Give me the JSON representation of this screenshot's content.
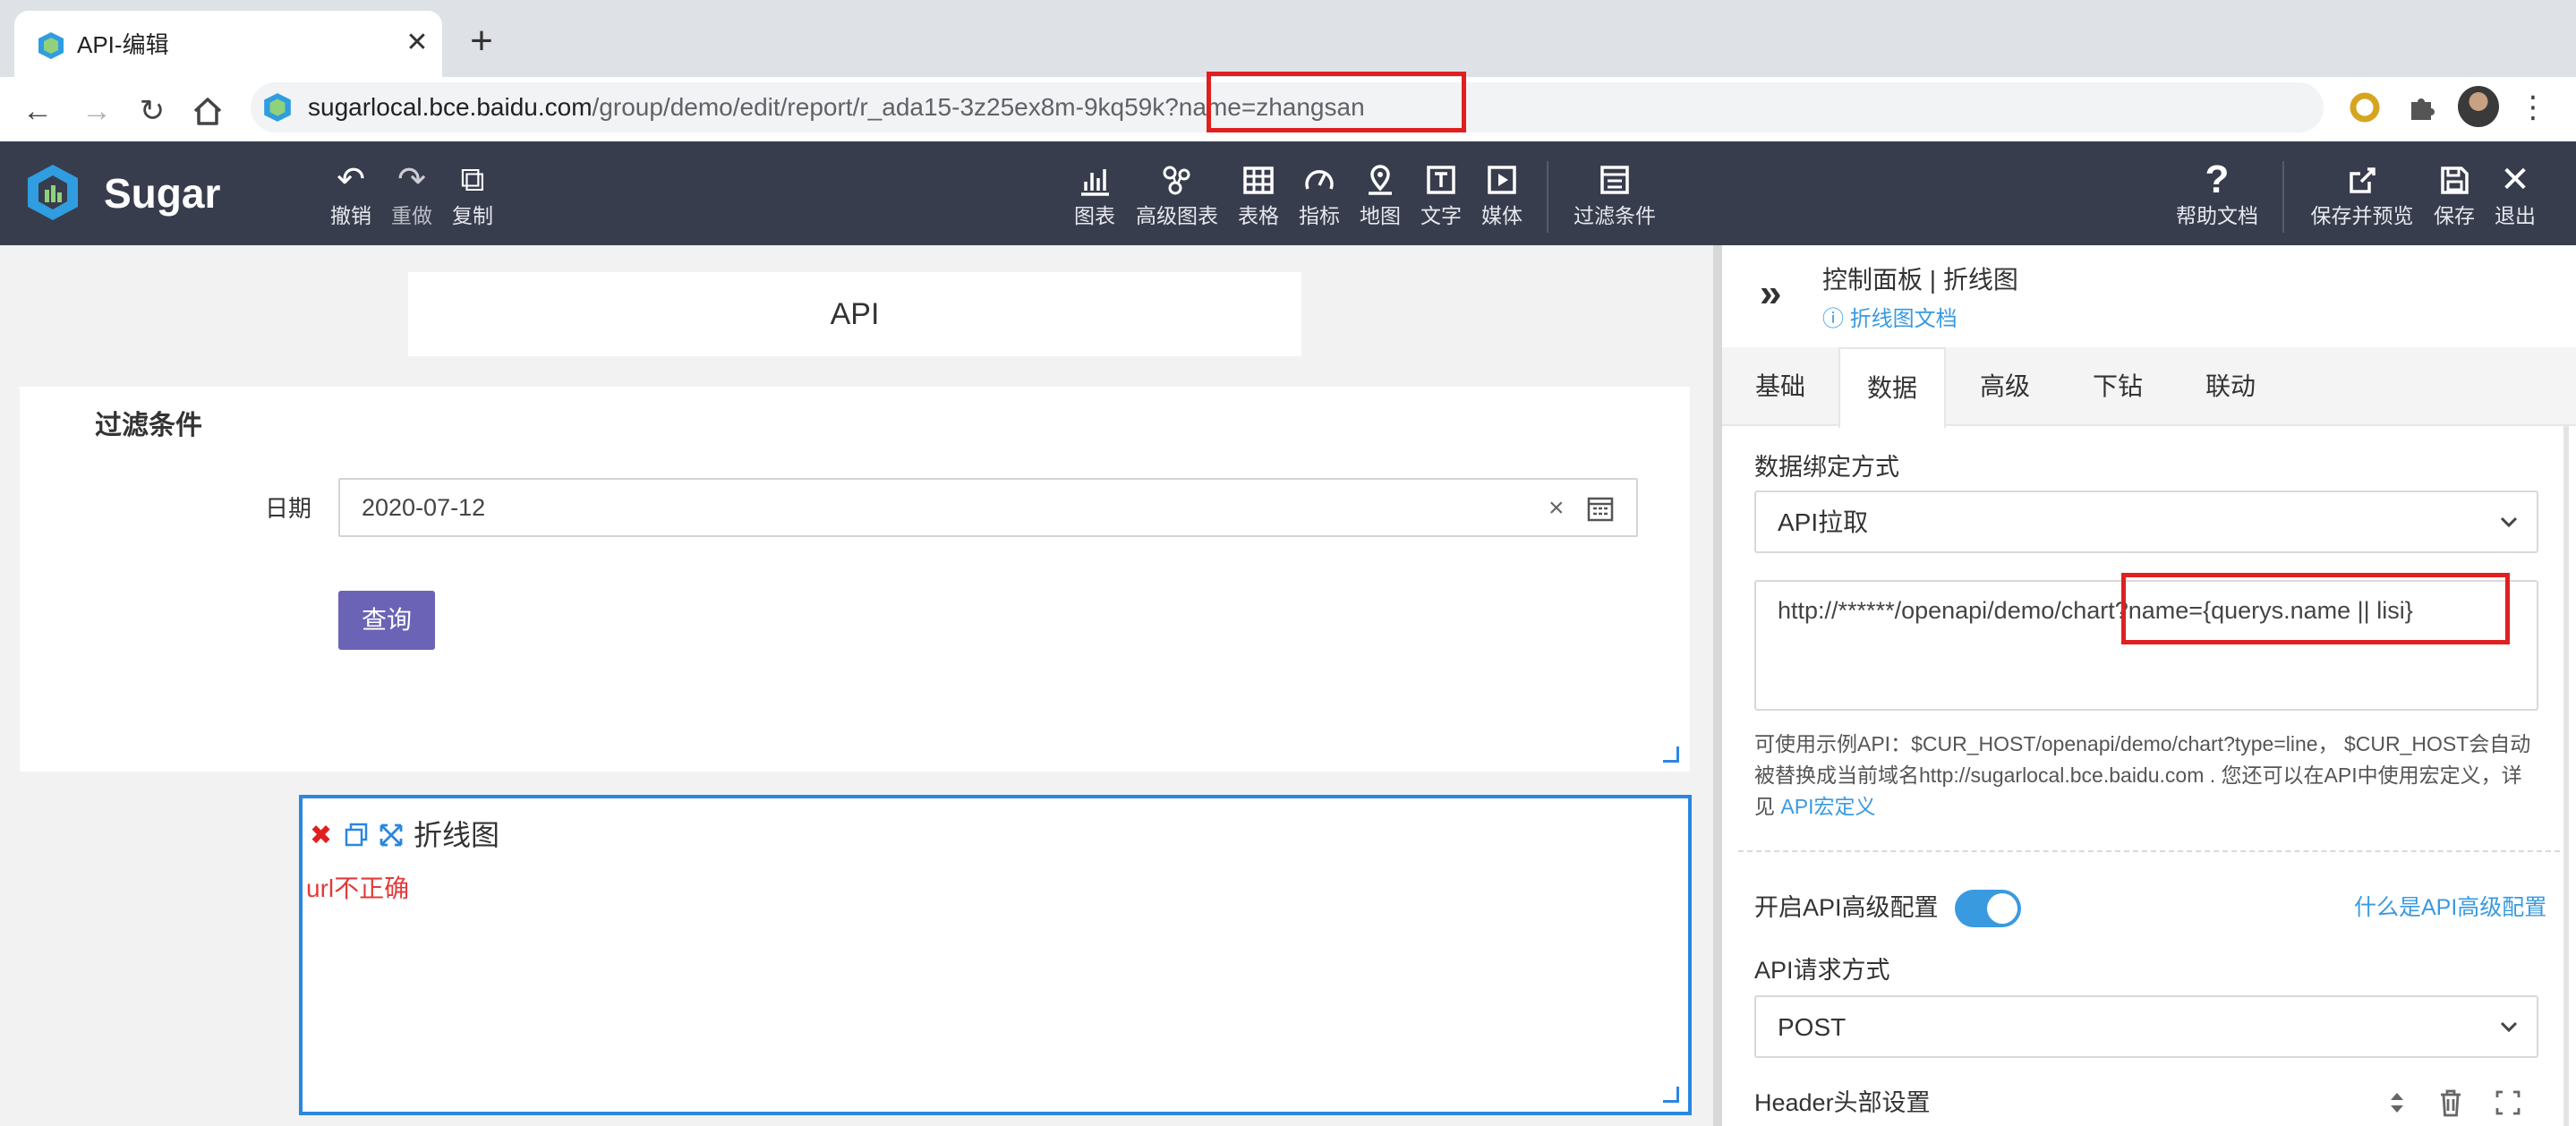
{
  "browser": {
    "tab_title": "API-编辑",
    "new_tab": "+",
    "close": "✕",
    "url_host": "sugarlocal.bce.baidu.com",
    "url_path": "/group/demo/edit/report/r_ada15-3z25ex8m-9kq59k?name=zhangsan"
  },
  "app": {
    "logo": "Sugar",
    "toolbar_left": [
      {
        "label": "撤销",
        "icon": "undo-icon"
      },
      {
        "label": "重做",
        "icon": "redo-icon"
      },
      {
        "label": "复制",
        "icon": "copy-icon"
      }
    ],
    "toolbar_center": [
      {
        "label": "图表",
        "icon": "bar-chart-icon"
      },
      {
        "label": "高级图表",
        "icon": "advanced-chart-icon"
      },
      {
        "label": "表格",
        "icon": "table-icon"
      },
      {
        "label": "指标",
        "icon": "gauge-icon"
      },
      {
        "label": "地图",
        "icon": "map-pin-icon"
      },
      {
        "label": "文字",
        "icon": "text-icon"
      },
      {
        "label": "媒体",
        "icon": "media-icon"
      },
      {
        "label": "过滤条件",
        "icon": "filter-list-icon"
      }
    ],
    "toolbar_right": [
      {
        "label": "帮助文档",
        "icon": "help-icon"
      },
      {
        "label": "保存并预览",
        "icon": "external-link-icon"
      },
      {
        "label": "保存",
        "icon": "save-icon"
      },
      {
        "label": "退出",
        "icon": "close-icon"
      }
    ]
  },
  "canvas": {
    "title": "API",
    "filter": {
      "title": "过滤条件",
      "date_label": "日期",
      "date_value": "2020-07-12",
      "clear": "×",
      "query_button": "查询"
    },
    "chart": {
      "delete": "✖",
      "title": "折线图",
      "error": "url不正确"
    }
  },
  "panel": {
    "collapse": "»",
    "title": "控制面板 | 折线图",
    "doc_link": "ⓘ 折线图文档",
    "tabs": [
      "基础",
      "数据",
      "高级",
      "下钻",
      "联动"
    ],
    "active_tab": "数据",
    "binding_label": "数据绑定方式",
    "binding_value": "API拉取",
    "api_url": "http://******/openapi/demo/chart?name={querys.name || lisi}",
    "api_help": "可使用示例API：$CUR_HOST/openapi/demo/chart?type=line， $CUR_HOST会自动被替换成当前域名http://sugarlocal.bce.baidu.com . 您还可以在API中使用宏定义，详见 ",
    "api_help_link": "API宏定义",
    "adv_label": "开启API高级配置",
    "adv_enabled": true,
    "adv_link": "什么是API高级配置",
    "method_label": "API请求方式",
    "method_value": "POST",
    "header_label": "Header头部设置"
  },
  "colors": {
    "appbar": "#383d4d",
    "accent": "#3a9ae0",
    "query_button": "#6b63b5",
    "highlight": "#e02020",
    "error": "#e03b3b"
  }
}
